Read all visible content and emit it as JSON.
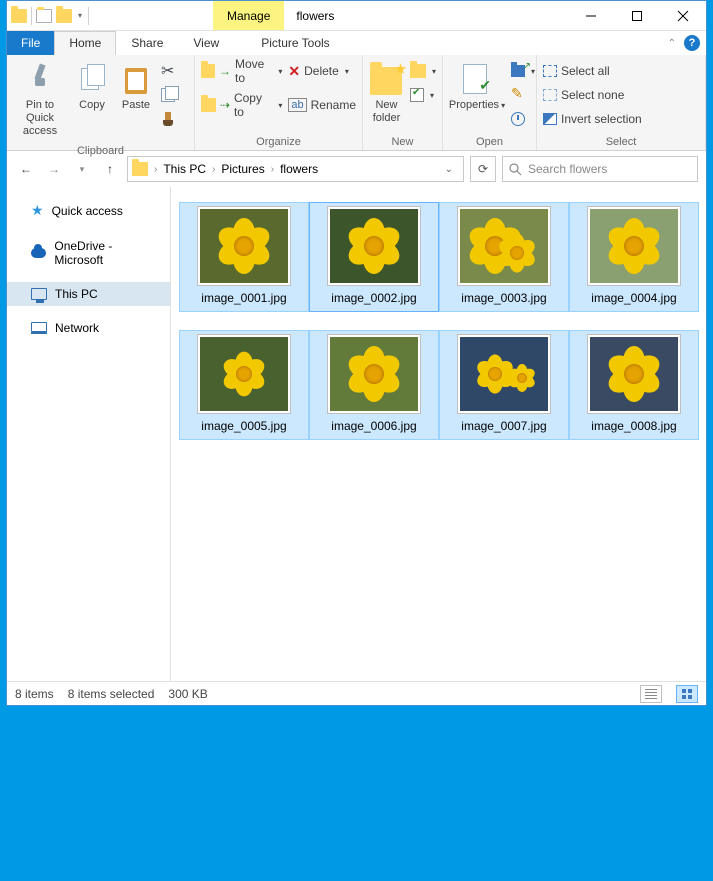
{
  "title": {
    "manage": "Manage",
    "picture_tools": "Picture Tools",
    "folder": "flowers"
  },
  "tabs": {
    "file": "File",
    "home": "Home",
    "share": "Share",
    "view": "View"
  },
  "ribbon": {
    "clipboard": {
      "label": "Clipboard",
      "pin": "Pin to Quick access",
      "copy": "Copy",
      "paste": "Paste"
    },
    "organize": {
      "label": "Organize",
      "moveto": "Move to",
      "copyto": "Copy to",
      "delete": "Delete",
      "rename": "Rename"
    },
    "new": {
      "label": "New",
      "newfolder": "New folder",
      "newitem": "New item",
      "easyaccess": "Easy access"
    },
    "open": {
      "label": "Open",
      "properties": "Properties",
      "open": "Open",
      "edit": "Edit",
      "history": "History"
    },
    "select": {
      "label": "Select",
      "selectall": "Select all",
      "selectnone": "Select none",
      "invert": "Invert selection"
    }
  },
  "breadcrumbs": [
    "This PC",
    "Pictures",
    "flowers"
  ],
  "search_placeholder": "Search flowers",
  "sidebar": {
    "quick": "Quick access",
    "onedrive": "OneDrive - Microsoft",
    "thispc": "This PC",
    "network": "Network"
  },
  "files": [
    {
      "name": "image_0001.jpg"
    },
    {
      "name": "image_0002.jpg"
    },
    {
      "name": "image_0003.jpg"
    },
    {
      "name": "image_0004.jpg"
    },
    {
      "name": "image_0005.jpg"
    },
    {
      "name": "image_0006.jpg"
    },
    {
      "name": "image_0007.jpg"
    },
    {
      "name": "image_0008.jpg"
    }
  ],
  "status": {
    "count": "8 items",
    "selected": "8 items selected",
    "size": "300 KB"
  }
}
